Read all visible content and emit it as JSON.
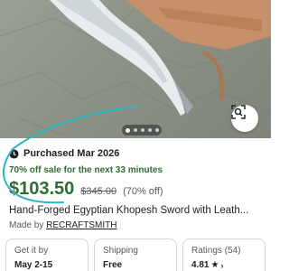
{
  "product": {
    "purchased_text": "Purchased Mar 2026",
    "sale_text": "70% off sale for the next 33 minutes",
    "price": "$103.50",
    "original_price": "$345.00",
    "discount": "(70% off)",
    "title": "Hand-Forged Egyptian Khopesh Sword with Leath...",
    "made_by_prefix": "Made by ",
    "shop_name": "RECRAFTSMITH"
  },
  "cards": [
    {
      "label": "Get it by",
      "value": "May 2-15"
    },
    {
      "label": "Shipping",
      "value": "Free"
    },
    {
      "label": "Ratings (54)",
      "value": "4.81"
    }
  ],
  "colors": {
    "price_green": "#2f6c33",
    "highlight_teal": "#2bb7c4"
  },
  "icons": {
    "purchased": "clock-icon",
    "visual_search": "image-search-icon",
    "rating": "star-icon"
  }
}
